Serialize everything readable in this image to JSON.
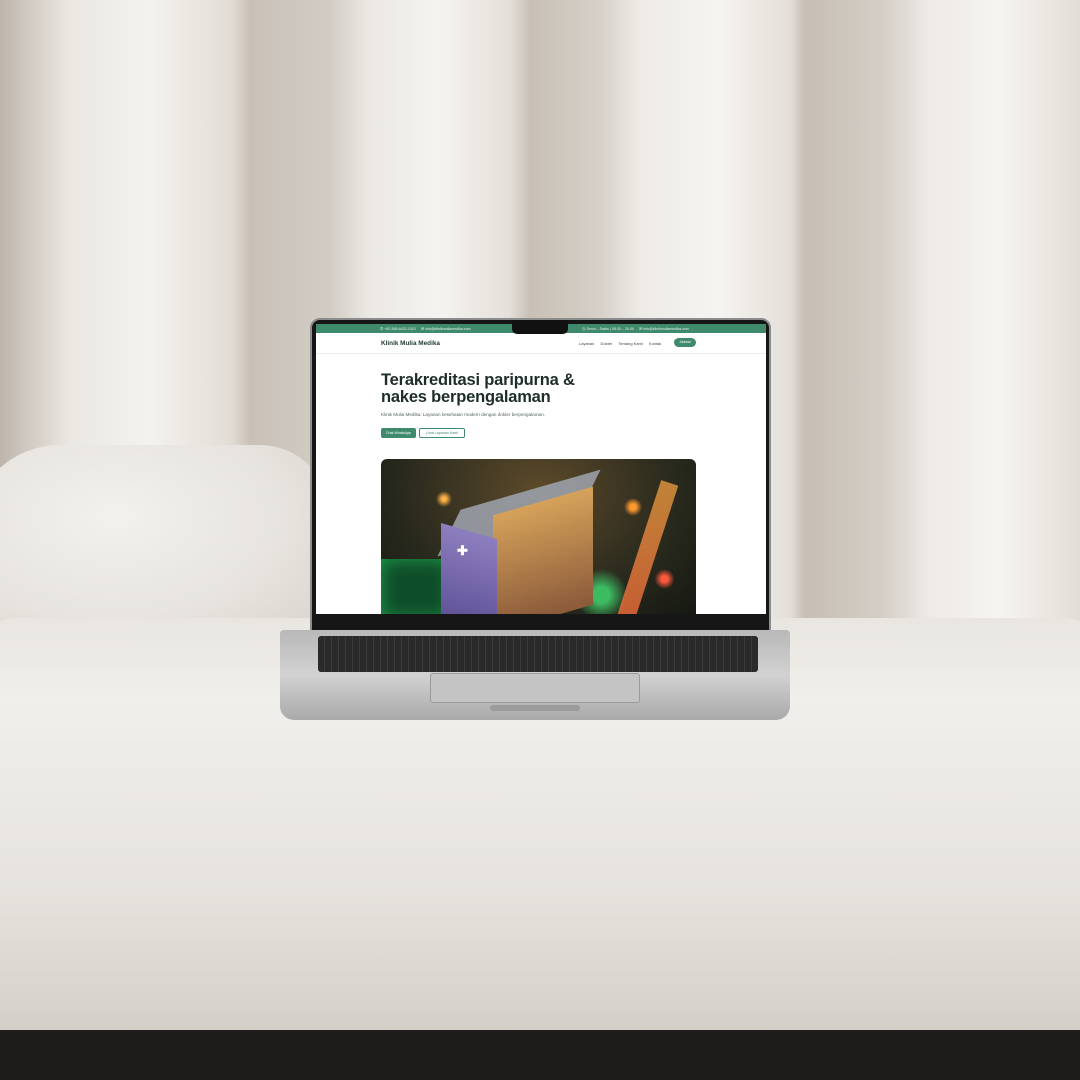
{
  "topbar": {
    "phone": "+62 858-6432-1012",
    "email_left": "info@klinikmuliamedika.com",
    "hours": "Senin – Sabtu | 08.00 – 20.00",
    "email_right": "info@klinikmuliamedika.com"
  },
  "navbar": {
    "brand": "Klinik Mulia Medika",
    "links": [
      "Layanan",
      "Dokter",
      "Tentang Kami",
      "Kontak"
    ],
    "cta": "Jadwal"
  },
  "hero": {
    "title": "Terakreditasi paripurna & nakes berpengalaman",
    "subtitle": "Klinik Mulia Medika: Layanan kesehatan modern dengan dokter berpengalaman.",
    "primary_button": "Chat WhatsApp",
    "secondary_button": "Lihat Layanan Kami"
  },
  "icons": {
    "phone": "phone-icon",
    "mail": "mail-icon",
    "clock": "clock-icon"
  },
  "colors": {
    "brand_green": "#3f8a6c",
    "heading": "#1f2d2a"
  }
}
